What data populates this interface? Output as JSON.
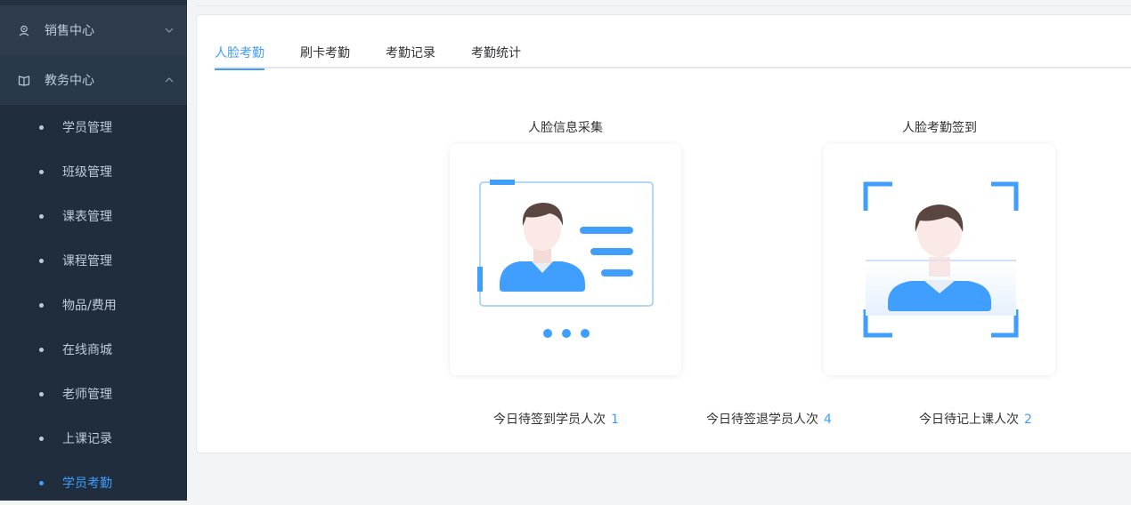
{
  "sidebar": {
    "groups": [
      {
        "label": "销售中心",
        "icon": "user-badge-icon",
        "chevron": "chevron-down-icon"
      },
      {
        "label": "教务中心",
        "icon": "book-icon",
        "chevron": "chevron-up-icon"
      }
    ],
    "items": [
      {
        "label": "学员管理"
      },
      {
        "label": "班级管理"
      },
      {
        "label": "课表管理"
      },
      {
        "label": "课程管理"
      },
      {
        "label": "物品/费用"
      },
      {
        "label": "在线商城"
      },
      {
        "label": "老师管理"
      },
      {
        "label": "上课记录"
      },
      {
        "label": "学员考勤"
      }
    ],
    "active_item": "学员考勤"
  },
  "tabs": [
    {
      "label": "人脸考勤",
      "active": true
    },
    {
      "label": "刷卡考勤",
      "active": false
    },
    {
      "label": "考勤记录",
      "active": false
    },
    {
      "label": "考勤统计",
      "active": false
    }
  ],
  "panels": [
    {
      "title": "人脸信息采集",
      "icon": "id-card-face-icon"
    },
    {
      "title": "人脸考勤签到",
      "icon": "face-scan-icon"
    }
  ],
  "stats": [
    {
      "label": "今日待签到学员人次",
      "value": "1"
    },
    {
      "label": "今日待签退学员人次",
      "value": "4"
    },
    {
      "label": "今日待记上课人次",
      "value": "2"
    }
  ],
  "colors": {
    "sidebar_bg": "#1f2d3d",
    "accent": "#409eff",
    "text": "#303133"
  }
}
